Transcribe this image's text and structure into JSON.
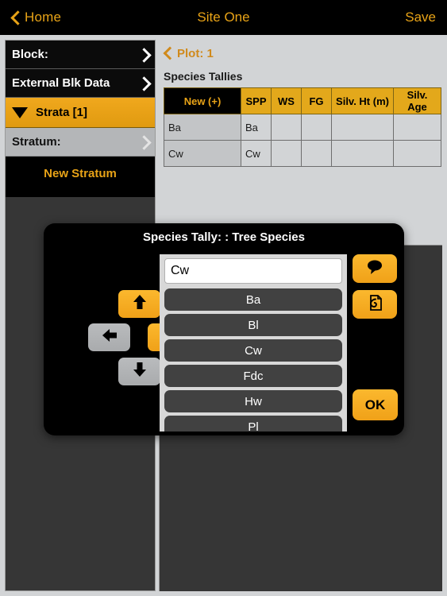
{
  "navbar": {
    "back_label": "Home",
    "title": "Site One",
    "save_label": "Save"
  },
  "sidebar": {
    "rows": [
      {
        "label": "Block:"
      },
      {
        "label": "External Blk Data"
      },
      {
        "label": "Strata [1]"
      },
      {
        "label": "Stratum:"
      }
    ],
    "new_stratum_label": "New Stratum"
  },
  "main": {
    "plot_label": "Plot: 1",
    "section_title": "Species Tallies",
    "table": {
      "headers": [
        "New (+)",
        "SPP",
        "WS",
        "FG",
        "Silv. Ht (m)",
        "Silv. Age"
      ],
      "rows": [
        [
          "Ba",
          "Ba",
          "",
          "",
          "",
          ""
        ],
        [
          "Cw",
          "Cw",
          "",
          "",
          "",
          ""
        ]
      ]
    }
  },
  "modal": {
    "title": "Species Tally: : Tree Species",
    "input_value": "Cw",
    "input_placeholder": "",
    "species_options": [
      "Ba",
      "Bl",
      "Cw",
      "Fdc",
      "Hw",
      "Pl"
    ],
    "ok_label": "OK",
    "dpad": {
      "up_state": "enabled",
      "down_state": "disabled",
      "left_state": "disabled",
      "right_state": "enabled"
    }
  },
  "colors": {
    "accent_orange": "#e8a317",
    "header_gold": "#e3a81b",
    "panel_gray": "#d2d4d6",
    "dark_panel": "#363636"
  }
}
